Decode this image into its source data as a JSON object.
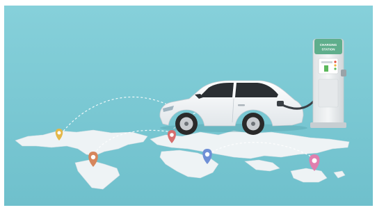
{
  "scene": {
    "background_color": "#7ecbd6",
    "map_color": "#eef3f5",
    "route_color": "#ffffff"
  },
  "car": {
    "body_color": "#ffffff",
    "window_color": "#2b2f33",
    "wheel_color": "#2a2a2a",
    "rim_color": "#c9ccd0"
  },
  "charging_station": {
    "sign_line1": "CHARGING",
    "sign_line2": "STATION",
    "sign_color": "#5fae8c",
    "body_color": "#eceeef",
    "indicator_colors": [
      "#e24a3b",
      "#f2b33d",
      "#5cb85c"
    ]
  },
  "map_pins": [
    {
      "name": "pin-north-america",
      "color": "#e3b84a"
    },
    {
      "name": "pin-south-america",
      "color": "#d6865c"
    },
    {
      "name": "pin-europe",
      "color": "#d76e6e"
    },
    {
      "name": "pin-africa-green",
      "color": "#63c27a"
    },
    {
      "name": "pin-africa",
      "color": "#6e8fd6"
    },
    {
      "name": "pin-australia",
      "color": "#e07fae"
    }
  ]
}
